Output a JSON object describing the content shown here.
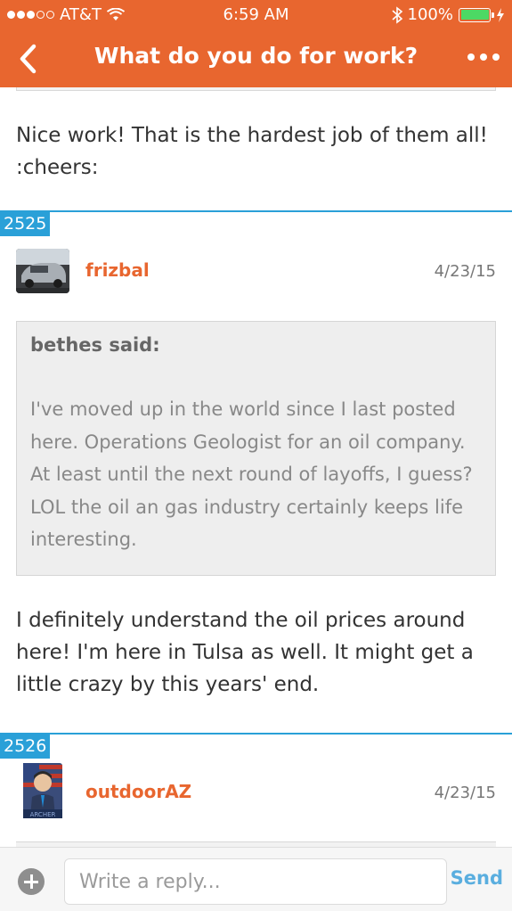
{
  "status_bar": {
    "carrier": "AT&T",
    "time": "6:59 AM",
    "battery": "100%"
  },
  "nav": {
    "title": "What do you do for work?"
  },
  "thread": {
    "intro_message": "Nice work! That is the hardest job of them all! :cheers:",
    "posts": [
      {
        "number": "2525",
        "username": "frizbal",
        "date": "4/23/15",
        "quote_author": "bethes said:",
        "quote_text": "I've moved up in the world since I last posted here. Operations Geologist for an oil company. At least until the next round of layoffs, I guess? LOL the oil an gas industry certainly keeps life interesting.",
        "message": "I definitely understand the oil prices around here! I'm here in Tulsa as well. It might get a little crazy by this years' end."
      },
      {
        "number": "2526",
        "username": "outdoorAZ",
        "date": "4/23/15"
      }
    ]
  },
  "reply_bar": {
    "placeholder": "Write a reply...",
    "send_label": "Send"
  },
  "colors": {
    "header": "#e8662f",
    "post_accent": "#2aa0d8",
    "username": "#e8662f",
    "send": "#5aaedf"
  },
  "icons": [
    "back-chevron-icon",
    "more-dots-icon",
    "wifi-icon",
    "bluetooth-icon",
    "battery-icon",
    "charging-icon",
    "plus-icon"
  ]
}
